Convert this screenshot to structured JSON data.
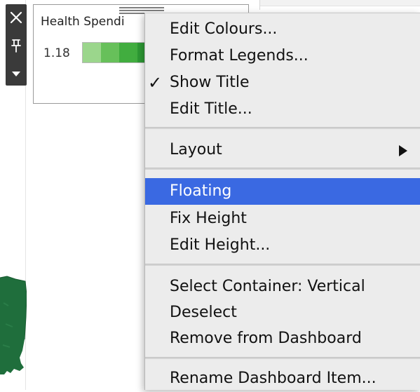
{
  "legend": {
    "title": "Health Spendi",
    "min_value": "1.18",
    "swatches": [
      "#9bd68c",
      "#67c05a",
      "#41ad3f",
      "#2e9b35"
    ]
  },
  "toolbar": {
    "close_icon": "close-icon",
    "pin_icon": "pin-icon",
    "more_icon": "caret-down-icon"
  },
  "menu": {
    "items": [
      {
        "label": "Edit Colours...",
        "checked": false
      },
      {
        "label": "Format Legends...",
        "checked": false
      },
      {
        "label": "Show Title",
        "checked": true,
        "check_mark": "✓"
      },
      {
        "label": "Edit Title...",
        "checked": false
      },
      {
        "label": "Layout",
        "submenu": true
      },
      {
        "label": "Floating",
        "highlighted": true
      },
      {
        "label": "Fix Height"
      },
      {
        "label": "Edit Height..."
      },
      {
        "label": "Select Container: Vertical"
      },
      {
        "label": "Deselect"
      },
      {
        "label": "Remove from Dashboard"
      },
      {
        "label": "Rename Dashboard Item..."
      }
    ]
  },
  "colors": {
    "menu_background": "#ececec",
    "menu_highlight": "#3a69e2",
    "toolbar_background": "#3a3a3a",
    "map_fill": "#1f6e3c"
  }
}
